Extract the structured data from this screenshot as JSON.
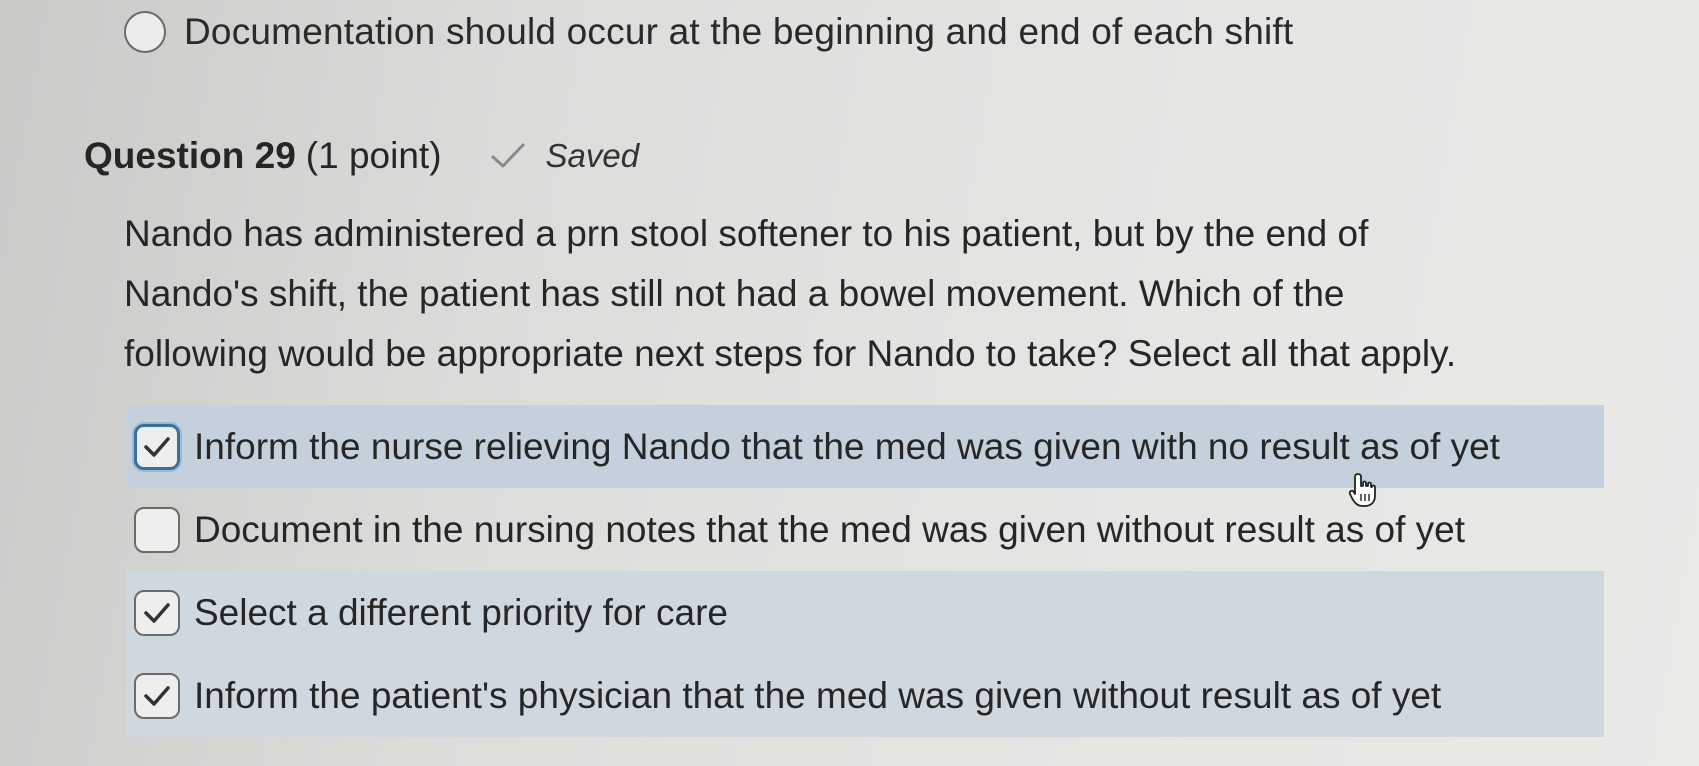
{
  "previous_question": {
    "option_label": "Documentation should occur at the beginning and end of each shift",
    "selected": false
  },
  "question": {
    "title": "Question 29",
    "points": "(1 point)",
    "status_label": "Saved",
    "text_lines": [
      "Nando has administered a prn stool softener to his patient, but by the end of",
      "Nando's shift, the patient has still not had a bowel movement.  Which of the",
      "following would be appropriate next steps for Nando to take?  Select all that apply."
    ],
    "options": [
      {
        "label": "Inform the nurse relieving Nando that the med was given with no result as of yet",
        "checked": true
      },
      {
        "label": "Document in the nursing notes that the med was given without result as of yet",
        "checked": false
      },
      {
        "label": "Select a different priority for care",
        "checked": true
      },
      {
        "label": "Inform the patient's physician that the med was given without result as of yet",
        "checked": true
      }
    ]
  },
  "icons": {
    "saved_check": "checkmark-icon",
    "cursor": "hand-pointer-icon"
  },
  "colors": {
    "selected_row": "#cfd8df",
    "focus_ring": "#3d6f9c",
    "check_mark": "#333333"
  }
}
